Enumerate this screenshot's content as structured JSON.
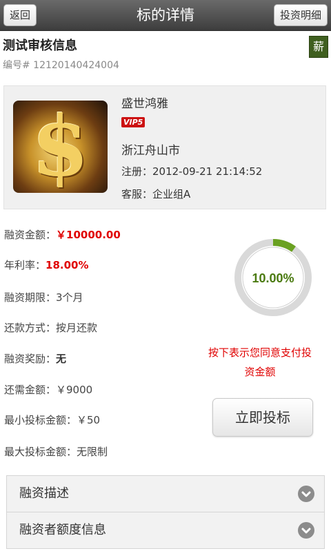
{
  "header": {
    "title": "标的详情",
    "back_label": "返回",
    "detail_label": "投资明细"
  },
  "item": {
    "title": "测试审核信息",
    "number": "编号# 12120140424004",
    "badge": "薪"
  },
  "company": {
    "name": "盛世鸿雅",
    "vip": "VIP5",
    "city": "浙江舟山市",
    "registered": "注册：2012-09-21 21:14:52",
    "service": "客服：企业组A"
  },
  "details": [
    {
      "label": "融资金额：",
      "value": "￥10000.00"
    },
    {
      "label": "年利率：",
      "value": "18.00%"
    },
    {
      "label": "融资期限：",
      "value": "3个月"
    },
    {
      "label": "还款方式：",
      "value": "按月还款"
    },
    {
      "label": "融资奖励：",
      "value": "无"
    },
    {
      "label": "还需金额：",
      "value": "￥9000"
    },
    {
      "label": "最小投标金额：",
      "value": "￥50"
    },
    {
      "label": "最大投标金额：",
      "value": "无限制"
    }
  ],
  "progress": {
    "label": "10.00%",
    "fraction": 0.1,
    "accent_color": "#6aa121"
  },
  "notice": "按下表示您同意支付投资金额",
  "invest_button": "立即投标",
  "accordion": [
    {
      "label": "融资描述",
      "icon": "chevron-down-icon"
    },
    {
      "label": "融资者额度信息",
      "icon": "chevron-down-icon"
    }
  ]
}
